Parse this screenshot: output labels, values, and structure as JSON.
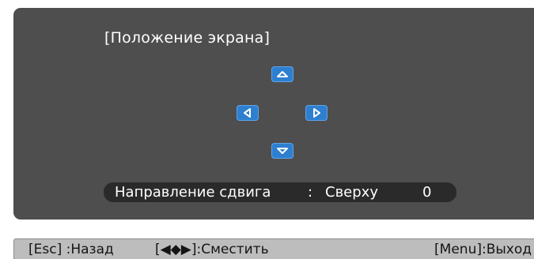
{
  "menu": {
    "title": "[Положение экрана]"
  },
  "arrows": {
    "up": "arrow-up-icon",
    "left": "arrow-left-icon",
    "right": "arrow-right-icon",
    "down": "arrow-down-icon"
  },
  "status": {
    "label": "Направление сдвига",
    "separator": ":",
    "direction": "Сверху",
    "amount": "0"
  },
  "footer": {
    "back": "[Esc] :Назад",
    "move": "[◀◆▶]:Сместить",
    "exit": "[Menu]:Выход"
  },
  "colors": {
    "panel": "#4e4e4e",
    "button": "#2e7fd0",
    "status_bar": "#2a2a2a",
    "footer": "#bdbdbd"
  }
}
